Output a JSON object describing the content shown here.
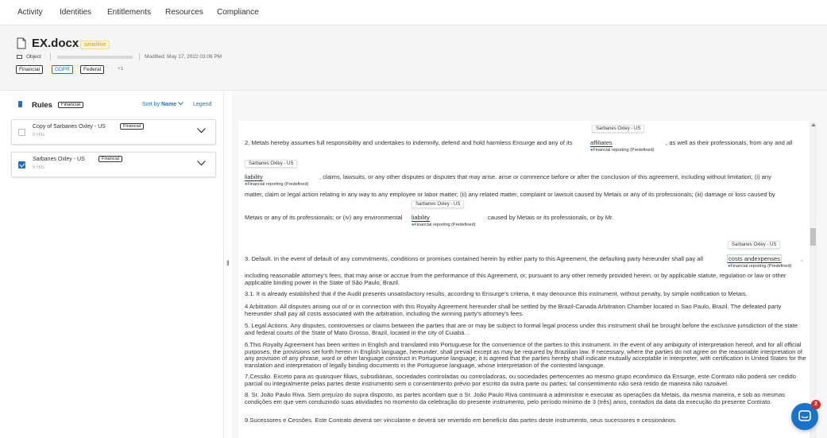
{
  "nav": {
    "tabs": [
      "Activity",
      "Identities",
      "Entitlements",
      "Resources",
      "Compliance"
    ]
  },
  "file": {
    "name": "EX.docx",
    "sensitivity": "sensitive",
    "type": "Object",
    "modified": "Modified: May 17, 2022 03:06 PM",
    "tags": [
      "Financial",
      "GDPR",
      "Federal"
    ],
    "more_tags": "+1"
  },
  "rules": {
    "title": "Rules",
    "badge": "Financial",
    "sort_prefix": "Sort by:",
    "sort_value": "Name",
    "legend": "Legend",
    "items": [
      {
        "name": "Copy of Sarbanes Oxley - US",
        "badge": "Financial",
        "hits": "8 Hits",
        "checked": false
      },
      {
        "name": "Sarbanes Oxley - US",
        "badge": "Financial",
        "hits": "8 Hits",
        "checked": true
      }
    ]
  },
  "document": {
    "line1_a": "2. Metals hereby assumes full responsibility and undertakes to indemnify, defend and hold harmless Ensurge and any of its",
    "line1_b": ", as well as their professionals, from any and all",
    "line2_b": ", claims, lawsuits, or any other disputes or disputes that may arise. arise or commence before or after the conclusion of this agreement, including without limitation; (i) any",
    "line3": "matter, claim or legal action relating in any way to any employee or labor matter; (ii) any related matter, complaint or lawsuit caused by Metais or any of its professionals; (iii) damage or loss caused by",
    "line4_a": "Metais or any of its professionals; or (iv) any environmental",
    "line4_b": "caused by Metais or its professionals, or by Mr.",
    "line5_a": "3. Default. In the event of default of any commitments, conditions or promises contained herein by either party to this Agreement, the defaulting party hereunder shall pay all",
    "line5_b": ",",
    "para6": "including reasonable attorney's fees, that may arise or accrue from the performance of this Agreement, or, pursuant to any other remedy provided herein, or by applicable statute, regulation or law or other applicable binding power in the State of São Paulo, Brazil.",
    "para7": "3.1. It is already established that if the Audit presents unsatisfactory results, according to Ensurge's criteria, it may denounce this instrument, without penalty, by simple notification to Metais.",
    "para8": "4 Arbitration. All disputes arising out of or in connection with this Royalty Agreement hereunder shall be settled by the Brazil-Canada Arbitration Chamber located in Sao Paulo, Brazil. The defeated party hereunder shall pay all costs associated with the arbitration, including the winning party's attorney's fees.",
    "para9": "5. Legal Actions. Any disputes, controversies or claims between the parties that are or may be subject to formal legal process under this instrument shall be brought before the exclusive jurisdiction of the state and federal courts of the State of Mato Grosso, Brazil, located in the city of Cuiabá. .",
    "para10": "6.This Royalty Agreement has been written in English and translated into Portuguese for the convenience of the parties to this instrument. In the event of any ambiguity of interpretation hereof, and for all official purposes, the provisions set forth herein in English language, hereunder, shall prevail except as may be required by Brazilian law. If necessary, where the parties do not agree on the reasonable interpretation of any provision of any phrase, word or other language construct in Portuguese language, it is agreed that the parties hereby shall indicate mutually acceptable in interpreter, with certification in United States for the translation and interpretation of legally binding documents in the Portuguese language, whose interpretation of the contested language.",
    "para11": "7.Cessão. Exceto para as quaisquer filiais, subsidiárias, sociedades controladas ou controladoras, ou sociedades pertencentes ao mesmo grupo econômico da Ensurge, este Contrato não poderá ser cedido parcial ou integralmente pelas partes deste instrumento sem o consentimento prévio por escrito da outra parte ou partes; tal consentimento não será retido de maneira não razoável.",
    "para12": "8. Sr. João Paulo Riva. Sem prejuízo do supra disposto, as partes acordam que o Sr. João Paulo Riva continuará a administrar e executar as operações da Metais, da mesma maneira, e sob as mesmas condições em que vem conduzindo suas atividades no momento da celebração do presente instrumento, pelo período mínimo de 3 (três) anos, contados da data da execução do presente Contrato.",
    "para13": "9.Sucessores e Cessões.  Este Contrato deverá ser vinculante e deverá ser revertido em benefício das partes deste instrumento, seus sucessores e cessionários.",
    "highlights": [
      {
        "rule": "Sarbanes Oxley - US",
        "word": "affiliates",
        "category": "Financial reporting (Predefined)"
      },
      {
        "rule": "Sarbanes Oxley - US",
        "word": "liability",
        "category": "Financial reporting (Predefined)"
      },
      {
        "rule": "Sarbanes Oxley - US",
        "word": "liability",
        "category": "Financial reporting (Predefined)"
      },
      {
        "rule": "Sarbanes Oxley - US",
        "word": "costs andexpenses",
        "category": "Financial reporting (Predefined)"
      }
    ]
  },
  "chat": {
    "badge": "2"
  },
  "colors": {
    "accent": "#1a73c8",
    "warning": "#c8a100",
    "alert": "#d62b2b"
  }
}
